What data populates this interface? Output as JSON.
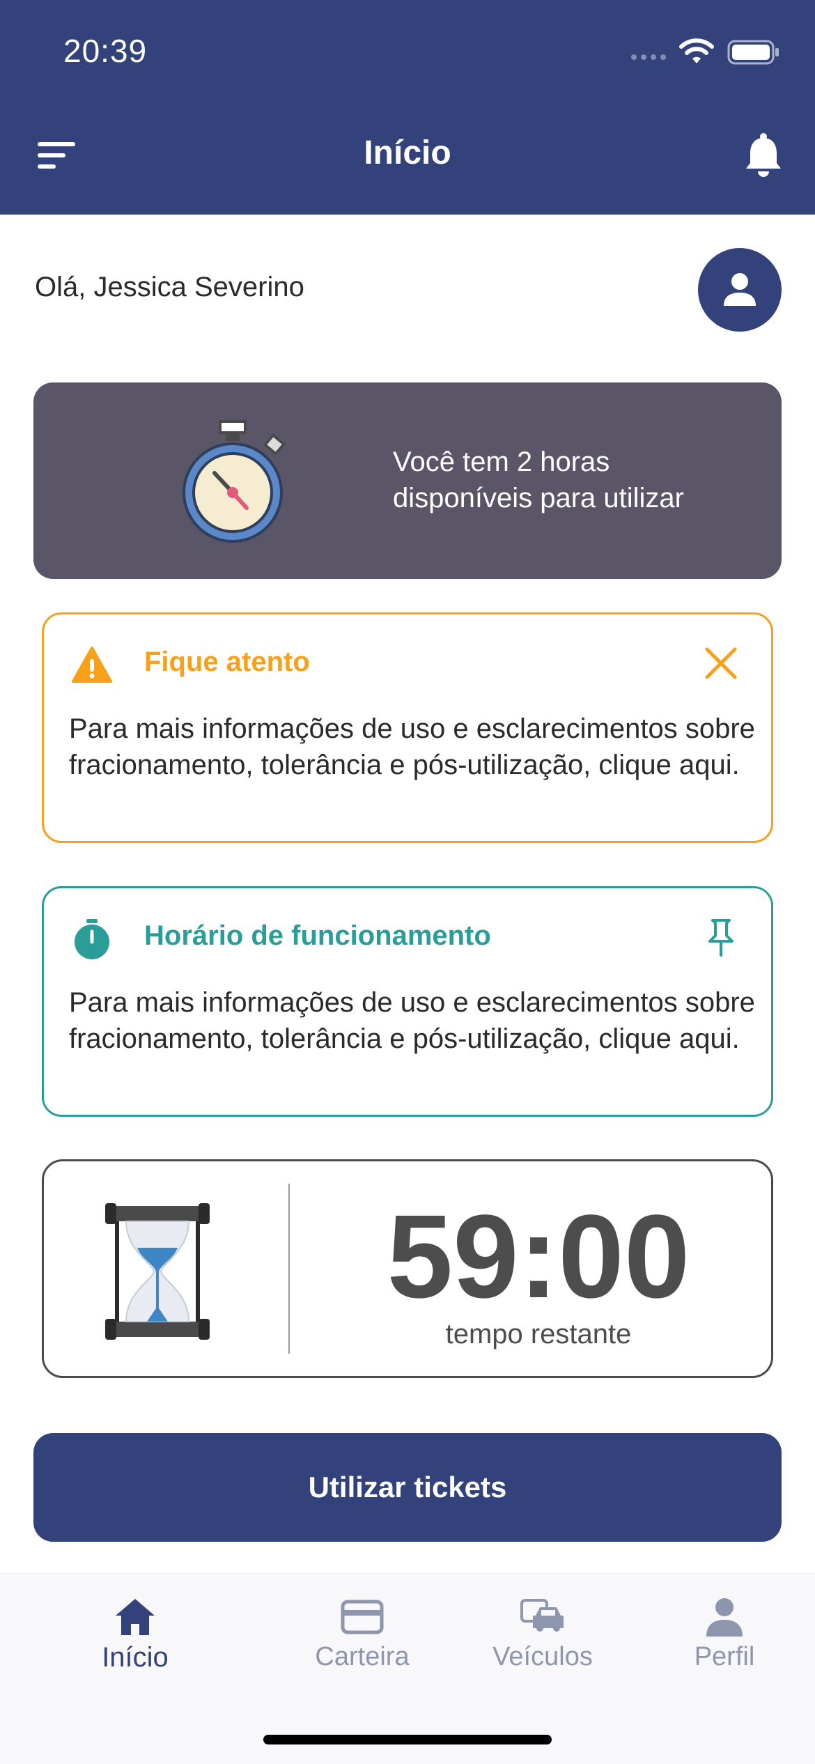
{
  "status_bar": {
    "time": "20:39"
  },
  "nav": {
    "title": "Início"
  },
  "greeting": "Olá, Jessica Severino",
  "hours_card": {
    "line1": "Você tem 2 horas",
    "line2": "disponíveis para utilizar"
  },
  "warning_alert": {
    "title": "Fique atento",
    "body": "Para mais informações de uso e esclarecimentos sobre fracionamento, tolerância e pós-utilização, clique aqui.",
    "color": "#f7a01a"
  },
  "info_alert": {
    "title": "Horário de funcionamento",
    "body": "Para mais informações de uso e esclarecimentos sobre fracionamento, tolerância e pós-utilização, clique aqui.",
    "color": "#2a9d99"
  },
  "timer": {
    "value": "59:00",
    "label": "tempo restante"
  },
  "primary_button": {
    "label": "Utilizar tickets"
  },
  "tabs": [
    {
      "label": "Início",
      "icon": "home-icon",
      "active": true
    },
    {
      "label": "Carteira",
      "icon": "card-icon",
      "active": false
    },
    {
      "label": "Veículos",
      "icon": "vehicles-icon",
      "active": false
    },
    {
      "label": "Perfil",
      "icon": "person-icon",
      "active": false
    }
  ],
  "colors": {
    "brand": "#33427a",
    "card_dark": "#5a5667",
    "inactive_tab": "#8d96ad"
  }
}
